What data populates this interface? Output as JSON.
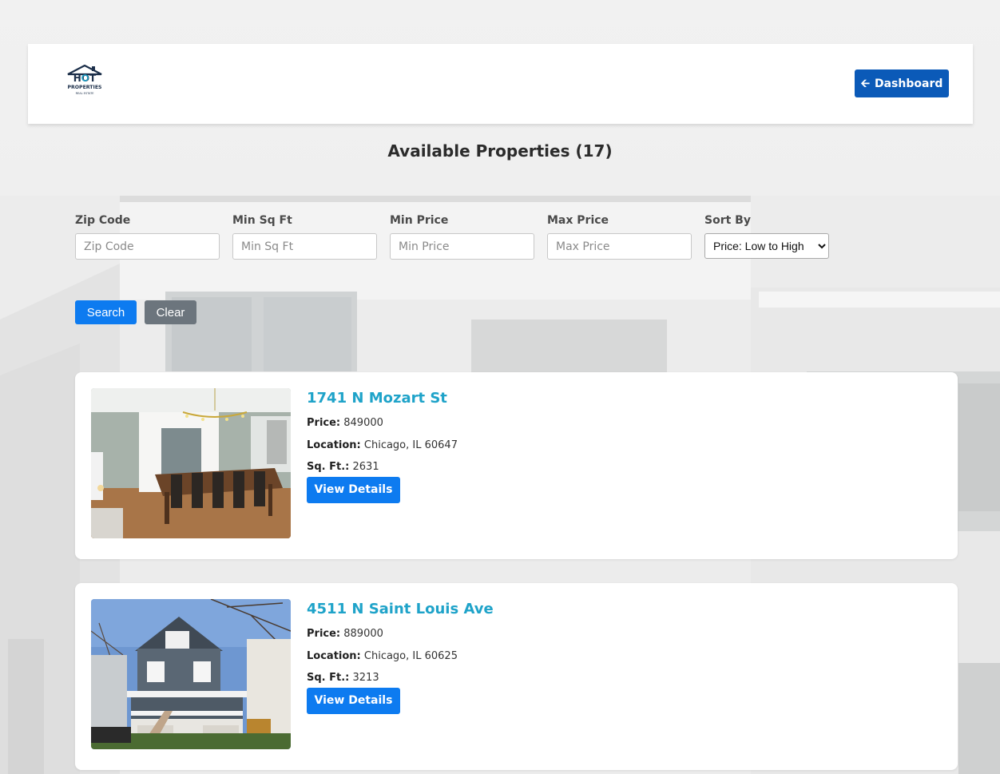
{
  "header": {
    "logo": {
      "line1": "HOT",
      "line2": "PROPERTIES",
      "line3": "REAL ESTATE"
    },
    "dashboard_button": {
      "icon": "arrow-left-icon",
      "label": "Dashboard"
    }
  },
  "page_title": "Available Properties (17)",
  "filters": {
    "zip": {
      "label": "Zip Code",
      "placeholder": "Zip Code",
      "value": ""
    },
    "min_sqft": {
      "label": "Min Sq Ft",
      "placeholder": "Min Sq Ft",
      "value": ""
    },
    "min_price": {
      "label": "Min Price",
      "placeholder": "Min Price",
      "value": ""
    },
    "max_price": {
      "label": "Max Price",
      "placeholder": "Max Price",
      "value": ""
    },
    "sort": {
      "label": "Sort By",
      "selected": "Price: Low to High"
    },
    "search_label": "Search",
    "clear_label": "Clear"
  },
  "listings": [
    {
      "address": "1741 N Mozart St",
      "price_label": "Price:",
      "price": "849000",
      "location_label": "Location:",
      "location": "Chicago, IL 60647",
      "sqft_label": "Sq. Ft.:",
      "sqft": "2631",
      "button": "View Details"
    },
    {
      "address": "4511 N Saint Louis Ave",
      "price_label": "Price:",
      "price": "889000",
      "location_label": "Location:",
      "location": "Chicago, IL 60625",
      "sqft_label": "Sq. Ft.:",
      "sqft": "3213",
      "button": "View Details"
    }
  ],
  "colors": {
    "primary": "#0d7bf0",
    "dashboard": "#0b5ab8",
    "secondary": "#6c757d",
    "link": "#1fa3c9"
  }
}
